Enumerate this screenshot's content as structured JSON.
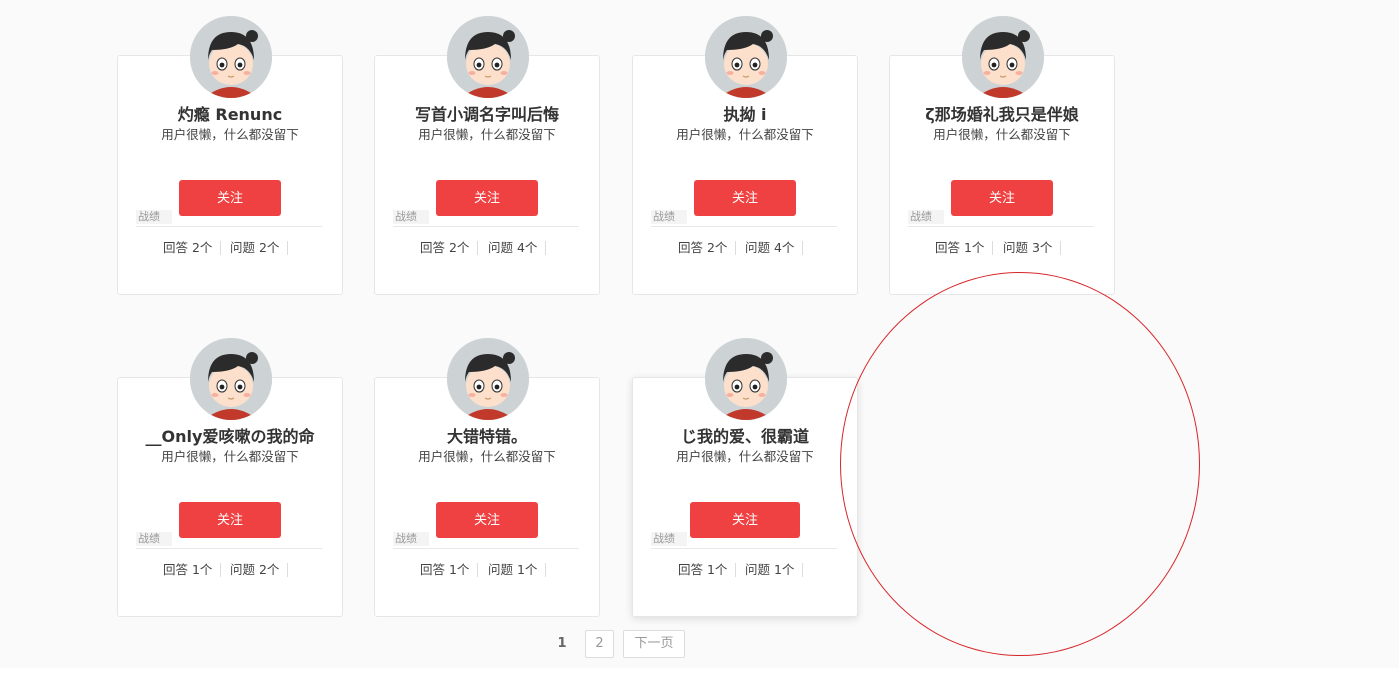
{
  "cards": [
    {
      "name": "灼瘾 Renunc",
      "bio": "用户很懒，什么都没留下",
      "follow_label": "关注",
      "stats_label": "战绩",
      "answers": "回答 2个",
      "questions": "问题 2个"
    },
    {
      "name": "写首小调名字叫后悔",
      "bio": "用户很懒，什么都没留下",
      "follow_label": "关注",
      "stats_label": "战绩",
      "answers": "回答 2个",
      "questions": "问题 4个"
    },
    {
      "name": "执拗 i",
      "bio": "用户很懒，什么都没留下",
      "follow_label": "关注",
      "stats_label": "战绩",
      "answers": "回答 2个",
      "questions": "问题 4个"
    },
    {
      "name": "ζ那场婚礼我只是伴娘",
      "bio": "用户很懒，什么都没留下",
      "follow_label": "关注",
      "stats_label": "战绩",
      "answers": "回答 1个",
      "questions": "问题 3个"
    },
    {
      "name": "__Only爱咳嗽の我的命",
      "bio": "用户很懒，什么都没留下",
      "follow_label": "关注",
      "stats_label": "战绩",
      "answers": "回答 1个",
      "questions": "问题 2个"
    },
    {
      "name": "大错特错。",
      "bio": "用户很懒，什么都没留下",
      "follow_label": "关注",
      "stats_label": "战绩",
      "answers": "回答 1个",
      "questions": "问题 1个"
    },
    {
      "name": "じ我的爱、很霸道",
      "bio": "用户很懒，什么都没留下",
      "follow_label": "关注",
      "stats_label": "战绩",
      "answers": "回答 1个",
      "questions": "问题 1个"
    }
  ],
  "pagination": {
    "current": "1",
    "page2": "2",
    "next": "下一页"
  },
  "colors": {
    "accent": "#f04142",
    "annotation": "#d8262a"
  },
  "icons": {
    "avatar": "cartoon-girl-avatar-icon"
  }
}
